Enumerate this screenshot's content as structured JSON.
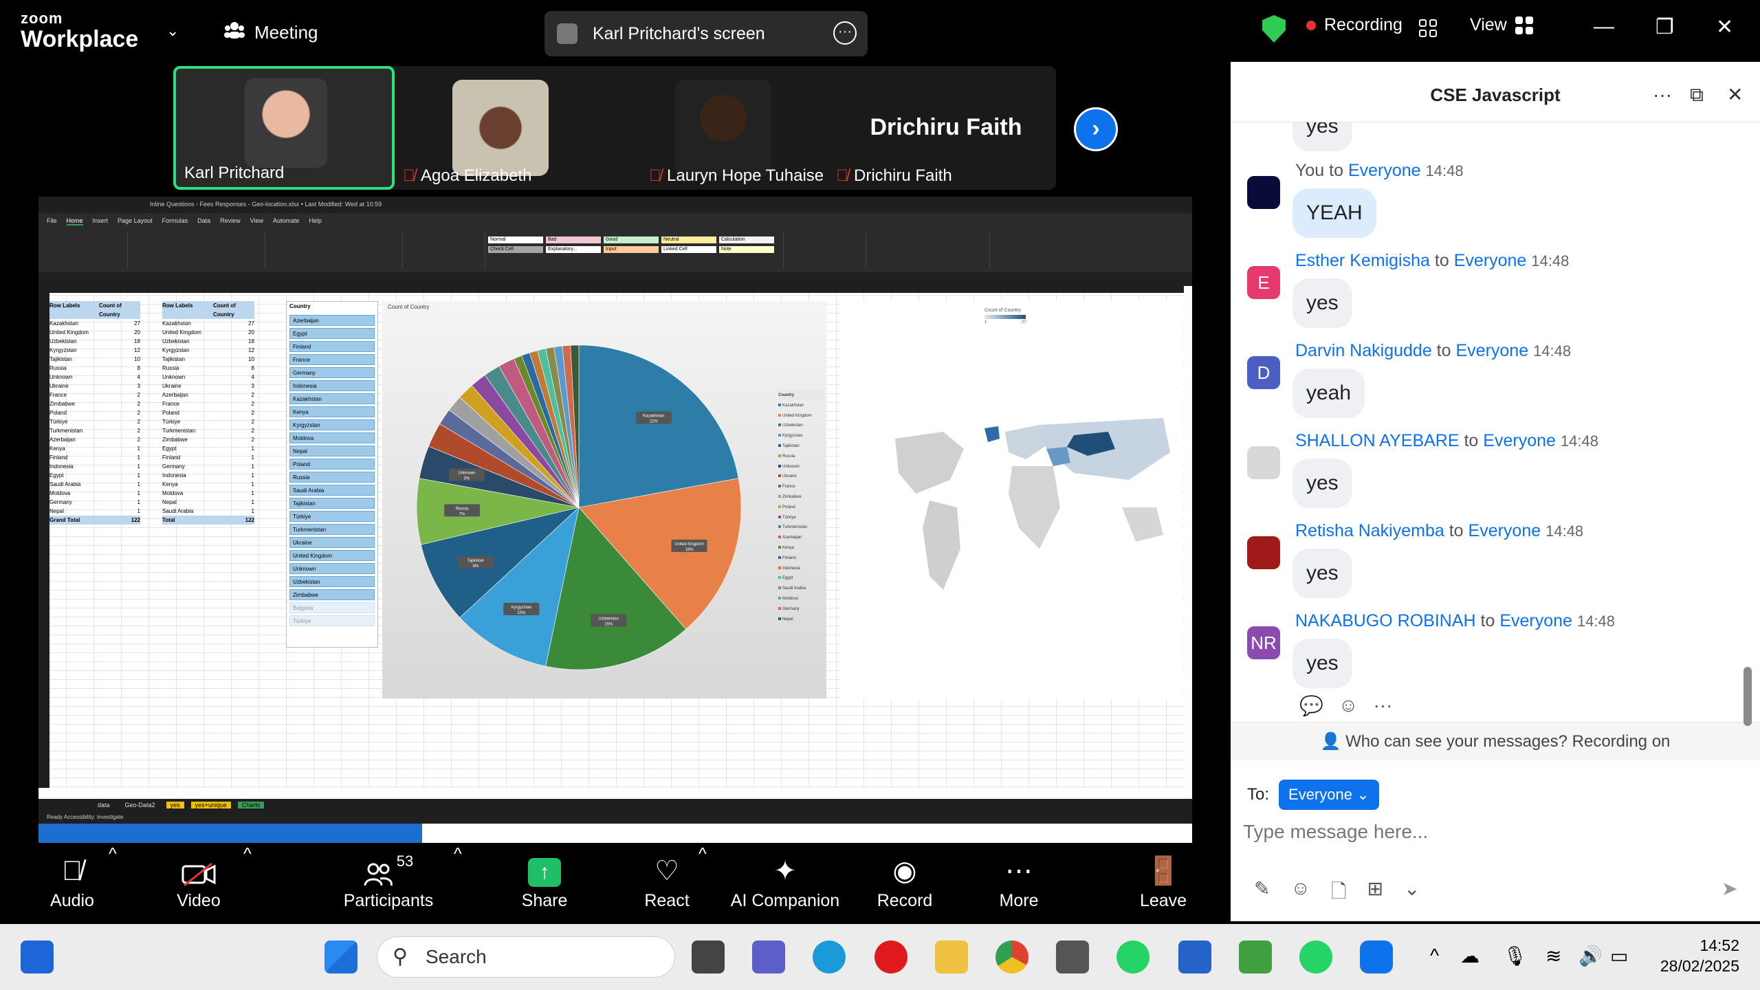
{
  "app": {
    "brand_top": "zoom",
    "brand_bottom": "Workplace",
    "meeting_label": "Meeting",
    "screen_label": "Karl Pritchard's screen",
    "recording_label": "Recording",
    "view_label": "View"
  },
  "participants": [
    {
      "name": "Karl Pritchard",
      "muted": false
    },
    {
      "name": "Agoa Elizabeth",
      "muted": true
    },
    {
      "name": "Lauryn Hope Tuhaise",
      "muted": true
    },
    {
      "name": "Drichiru Faith",
      "muted": true
    }
  ],
  "featured_name": "Drichiru Faith",
  "excel": {
    "title": "Inline Questions - Fees Responses - Geo-location.xlsx • Last Modified: Wed at 10:59",
    "tabs": [
      "File",
      "Home",
      "Insert",
      "Page Layout",
      "Formulas",
      "Data",
      "Review",
      "View",
      "Automate",
      "Help"
    ],
    "styles": [
      "Normal",
      "Bad",
      "Good",
      "Neutral",
      "Calculation",
      "Check Cell",
      "Explanatory...",
      "Input",
      "Linked Cell",
      "Note"
    ],
    "sheet_tabs": [
      "data",
      "Geo-Data2",
      "yes",
      "yes+unique",
      "Charts"
    ],
    "status": "Ready   Accessibility: Investigate",
    "pivot1_headers": [
      "Row Labels",
      "Count of Country"
    ],
    "pivot1_rows": [
      [
        "Kazakhstan",
        "27"
      ],
      [
        "United Kingdom",
        "20"
      ],
      [
        "Uzbekistan",
        "18"
      ],
      [
        "Kyrgyzstan",
        "12"
      ],
      [
        "Tajikistan",
        "10"
      ],
      [
        "Russia",
        "8"
      ],
      [
        "Unknown",
        "4"
      ],
      [
        "Ukraine",
        "3"
      ],
      [
        "France",
        "2"
      ],
      [
        "Zimbabwe",
        "2"
      ],
      [
        "Poland",
        "2"
      ],
      [
        "Türkiye",
        "2"
      ],
      [
        "Turkmenistan",
        "2"
      ],
      [
        "Azerbaijan",
        "2"
      ],
      [
        "Kenya",
        "1"
      ],
      [
        "Finland",
        "1"
      ],
      [
        "Indonesia",
        "1"
      ],
      [
        "Egypt",
        "1"
      ],
      [
        "Saudi Arabia",
        "1"
      ],
      [
        "Moldova",
        "1"
      ],
      [
        "Germany",
        "1"
      ],
      [
        "Nepal",
        "1"
      ]
    ],
    "pivot1_total": [
      "Grand Total",
      "122"
    ],
    "pivot2_headers": [
      "Row Labels",
      "Count of Country"
    ],
    "pivot2_rows": [
      [
        "Kazakhstan",
        "27"
      ],
      [
        "United Kingdom",
        "20"
      ],
      [
        "Uzbekistan",
        "18"
      ],
      [
        "Kyrgyzstan",
        "12"
      ],
      [
        "Tajikistan",
        "10"
      ],
      [
        "Russia",
        "8"
      ],
      [
        "Unknown",
        "4"
      ],
      [
        "Ukraine",
        "3"
      ],
      [
        "Azerbaijan",
        "2"
      ],
      [
        "France",
        "2"
      ],
      [
        "Poland",
        "2"
      ],
      [
        "Türkiye",
        "2"
      ],
      [
        "Turkmenistan",
        "2"
      ],
      [
        "Zimbabwe",
        "2"
      ],
      [
        "Egypt",
        "1"
      ],
      [
        "Finland",
        "1"
      ],
      [
        "Germany",
        "1"
      ],
      [
        "Indonesia",
        "1"
      ],
      [
        "Kenya",
        "1"
      ],
      [
        "Moldova",
        "1"
      ],
      [
        "Nepal",
        "1"
      ],
      [
        "Saudi Arabia",
        "1"
      ]
    ],
    "pivot2_total": [
      "Total",
      "122"
    ],
    "slicer_title": "Country",
    "slicer_items": [
      "Azerbaijan",
      "Egypt",
      "Finland",
      "France",
      "Germany",
      "Indonesia",
      "Kazakhstan",
      "Kenya",
      "Kyrgyzstan",
      "Moldova",
      "Nepal",
      "Poland",
      "Russia",
      "Saudi Arabia",
      "Tajikistan",
      "Türkiye",
      "Turkmenistan",
      "Ukraine",
      "United Kingdom",
      "Unknown",
      "Uzbekistan",
      "Zimbabwe"
    ],
    "slicer_dim_items": [
      "Bulgaria",
      "Türkiye"
    ],
    "pie_title": "Count of Country",
    "map_title": "Count of Country",
    "map_scale": [
      "1",
      "27"
    ],
    "legend_title": "Country"
  },
  "chart_data": {
    "type": "pie",
    "title": "",
    "categories": [
      "Kazakhstan",
      "United Kingdom",
      "Uzbekistan",
      "Kyrgyzstan",
      "Tajikistan",
      "Russia",
      "Unknown",
      "Ukraine",
      "France",
      "Zimbabwe",
      "Poland",
      "Türkiye",
      "Turkmenistan",
      "Azerbaijan",
      "Kenya",
      "Finland",
      "Indonesia",
      "Egypt",
      "Saudi Arabia",
      "Moldova",
      "Germany",
      "Nepal"
    ],
    "values": [
      27,
      20,
      18,
      12,
      10,
      8,
      4,
      3,
      2,
      2,
      2,
      2,
      2,
      2,
      1,
      1,
      1,
      1,
      1,
      1,
      1,
      1
    ],
    "labels_shown": [
      {
        "name": "Kazakhstan",
        "pct": "22%"
      },
      {
        "name": "United Kingdom",
        "pct": "16%"
      },
      {
        "name": "Uzbekistan",
        "pct": "15%"
      },
      {
        "name": "Kyrgyzstan",
        "pct": "10%"
      },
      {
        "name": "Tajikistan",
        "pct": "8%"
      },
      {
        "name": "Russia",
        "pct": "7%"
      },
      {
        "name": "Unknown",
        "pct": "3%"
      }
    ],
    "colors": [
      "#2e7ca8",
      "#e8804a",
      "#3a8a3a",
      "#3aa0d8",
      "#1f5f88",
      "#7ab648",
      "#2a4a6a",
      "#b04a2a",
      "#5a6a9a",
      "#a0a0a0",
      "#d0a020",
      "#8a4aa0",
      "#4a8a8a",
      "#c05a80",
      "#6a8a2a",
      "#2a6aa0",
      "#c07a3a",
      "#4ac0a0",
      "#8a8a4a",
      "#5a9ad0",
      "#d06a4a",
      "#3a5a3a"
    ]
  },
  "toolbar": [
    {
      "label": "Audio"
    },
    {
      "label": "Video"
    },
    {
      "label": "Participants",
      "count": "53"
    },
    {
      "label": "Share"
    },
    {
      "label": "React"
    },
    {
      "label": "AI Companion"
    },
    {
      "label": "Record"
    },
    {
      "label": "More"
    },
    {
      "label": "Leave"
    }
  ],
  "chat": {
    "title": "CSE Javascript",
    "partial_top": "yes",
    "to_word": "to",
    "messages": [
      {
        "sender": "You",
        "to": "Everyone",
        "time": "14:48",
        "text": "YEAH",
        "initials": "",
        "color": "#0b0b3a",
        "me": true
      },
      {
        "sender": "Esther Kemigisha",
        "to": "Everyone",
        "time": "14:48",
        "text": "yes",
        "initials": "E",
        "color": "#e63a6e"
      },
      {
        "sender": "Darvin Nakigudde",
        "to": "Everyone",
        "time": "14:48",
        "text": "yeah",
        "initials": "D",
        "color": "#4a5fc1"
      },
      {
        "sender": "SHALLON AYEBARE",
        "to": "Everyone",
        "time": "14:48",
        "text": "yes",
        "initials": "",
        "color": "#d8d8d8"
      },
      {
        "sender": "Retisha Nakiyemba",
        "to": "Everyone",
        "time": "14:48",
        "text": "yes",
        "initials": "",
        "color": "#a01a1a"
      },
      {
        "sender": "NAKABUGO ROBINAH",
        "to": "Everyone",
        "time": "14:48",
        "text": "yes",
        "initials": "NR",
        "color": "#8a4ab0"
      }
    ],
    "notice": "Who can see your messages? Recording on",
    "to_label": "To:",
    "to_value": "Everyone",
    "input_placeholder": "Type message here..."
  },
  "taskbar": {
    "search_label": "Search",
    "time": "14:52",
    "date": "28/02/2025"
  }
}
